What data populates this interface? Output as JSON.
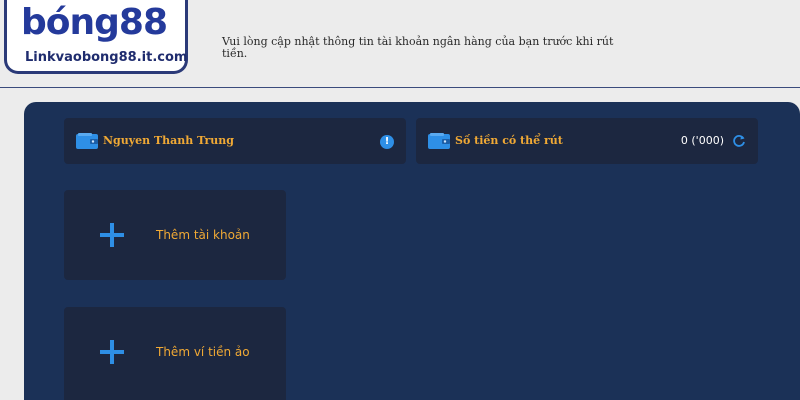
{
  "logo": {
    "wordmark": "bóng88",
    "site": "Linkvaobong88.it.com"
  },
  "notice": {
    "text": "Vui lòng cập nhật thông tin tài khoản ngân hàng của bạn trước khi rút tiền."
  },
  "account_card": {
    "icon": "wallet-icon",
    "name": "Nguyen Thanh Trung",
    "info_icon": "info-icon",
    "info_glyph": "!"
  },
  "balance_card": {
    "icon": "wallet-icon",
    "label": "Số tiền có thể rút",
    "value": "0 ('000)",
    "refresh_icon": "refresh-icon"
  },
  "actions": [
    {
      "icon": "plus-icon",
      "label": "Thêm tài khoản"
    },
    {
      "icon": "plus-icon",
      "label": "Thêm ví tiền ảo"
    }
  ],
  "colors": {
    "panel": "#1b3157",
    "card": "#1c2740",
    "accent_text": "#f0a935",
    "icon_blue": "#2e8fe6"
  }
}
